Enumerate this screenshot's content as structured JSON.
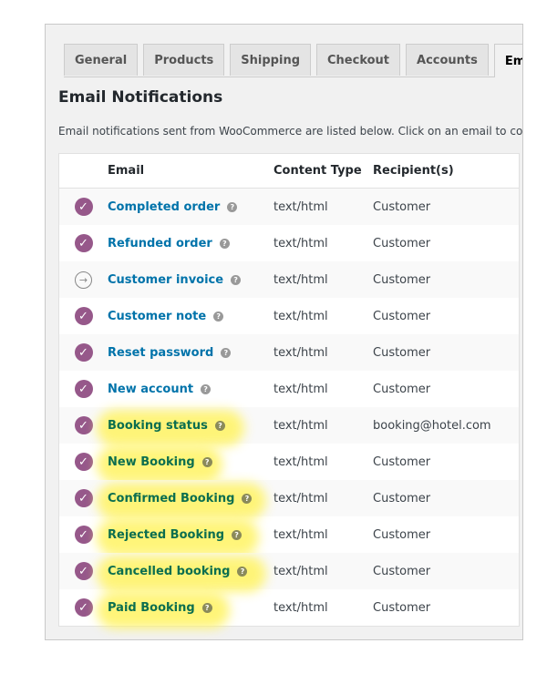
{
  "tabs": [
    {
      "label": "General"
    },
    {
      "label": "Products"
    },
    {
      "label": "Shipping"
    },
    {
      "label": "Checkout"
    },
    {
      "label": "Accounts"
    },
    {
      "label": "Emails",
      "active": true
    }
  ],
  "title": "Email Notifications",
  "description": "Email notifications sent from WooCommerce are listed below. Click on an email to confi",
  "columns": {
    "email": "Email",
    "content_type": "Content Type",
    "recipients": "Recipient(s)"
  },
  "colors": {
    "enabled": "#96588a",
    "link": "#0073aa",
    "highlight": "#fff46b",
    "highlight_text": "#0b6e4f"
  },
  "help_glyph": "?",
  "rows": [
    {
      "email": "Completed order",
      "type": "text/html",
      "recipient": "Customer",
      "status": "enabled",
      "highlighted": false
    },
    {
      "email": "Refunded order",
      "type": "text/html",
      "recipient": "Customer",
      "status": "enabled",
      "highlighted": false
    },
    {
      "email": "Customer invoice",
      "type": "text/html",
      "recipient": "Customer",
      "status": "manual",
      "highlighted": false
    },
    {
      "email": "Customer note",
      "type": "text/html",
      "recipient": "Customer",
      "status": "enabled",
      "highlighted": false
    },
    {
      "email": "Reset password",
      "type": "text/html",
      "recipient": "Customer",
      "status": "enabled",
      "highlighted": false
    },
    {
      "email": "New account",
      "type": "text/html",
      "recipient": "Customer",
      "status": "enabled",
      "highlighted": false
    },
    {
      "email": "Booking status",
      "type": "text/html",
      "recipient": "booking@hotel.com",
      "status": "enabled",
      "highlighted": true
    },
    {
      "email": "New Booking",
      "type": "text/html",
      "recipient": "Customer",
      "status": "enabled",
      "highlighted": true
    },
    {
      "email": "Confirmed Booking",
      "type": "text/html",
      "recipient": "Customer",
      "status": "enabled",
      "highlighted": true
    },
    {
      "email": "Rejected Booking",
      "type": "text/html",
      "recipient": "Customer",
      "status": "enabled",
      "highlighted": true
    },
    {
      "email": "Cancelled booking",
      "type": "text/html",
      "recipient": "Customer",
      "status": "enabled",
      "highlighted": true
    },
    {
      "email": "Paid Booking",
      "type": "text/html",
      "recipient": "Customer",
      "status": "enabled",
      "highlighted": true
    }
  ]
}
